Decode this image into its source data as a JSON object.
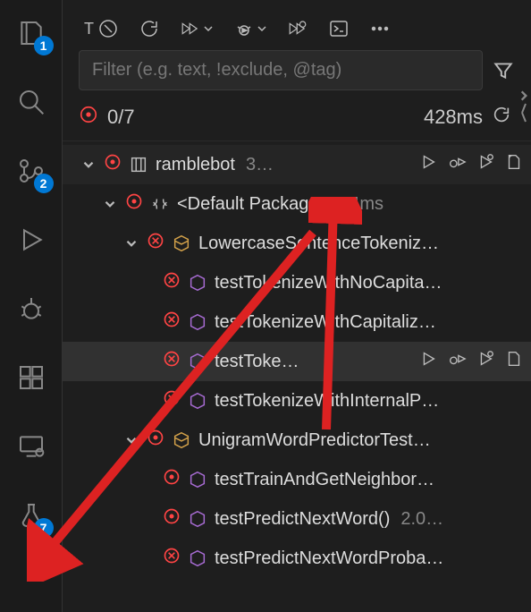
{
  "activityBar": {
    "explorerBadge": "1",
    "scmBadge": "2",
    "testingBadge": "7"
  },
  "filter": {
    "placeholder": "Filter (e.g. text, !exclude, @tag)"
  },
  "summary": {
    "count": "0/7",
    "time": "428ms"
  },
  "tree": {
    "project": {
      "label": "ramblebot",
      "time": "3…"
    },
    "pkg": {
      "label": "<Default Package>",
      "time": "34ms"
    },
    "class1": {
      "label": "LowercaseSentenceTokeniz…"
    },
    "c1_tests": [
      {
        "label": "testTokenizeWithNoCapita…"
      },
      {
        "label": "testTokenizeWithCapitaliz…"
      },
      {
        "label": "testToke…"
      },
      {
        "label": "testTokenizeWithInternalP…"
      }
    ],
    "class2": {
      "label": "UnigramWordPredictorTest…"
    },
    "c2_tests": [
      {
        "label": "testTrainAndGetNeighbor…"
      },
      {
        "label": "testPredictNextWord()",
        "time": "2.0…"
      },
      {
        "label": "testPredictNextWordProba…"
      }
    ]
  }
}
